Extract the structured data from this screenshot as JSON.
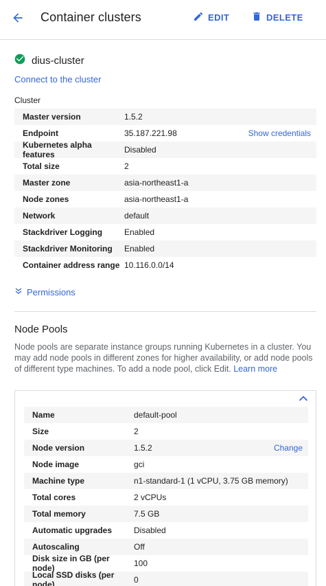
{
  "header": {
    "title": "Container clusters",
    "edit_label": "EDIT",
    "delete_label": "DELETE"
  },
  "cluster": {
    "name": "dius-cluster",
    "status": "running",
    "connect_label": "Connect to the cluster",
    "section_label": "Cluster",
    "details": [
      {
        "key": "Master version",
        "value": "1.5.2"
      },
      {
        "key": "Endpoint",
        "value": "35.187.221.98",
        "link": "Show credentials"
      },
      {
        "key": "Kubernetes alpha features",
        "value": "Disabled"
      },
      {
        "key": "Total size",
        "value": "2"
      },
      {
        "key": "Master zone",
        "value": "asia-northeast1-a"
      },
      {
        "key": "Node zones",
        "value": "asia-northeast1-a"
      },
      {
        "key": "Network",
        "value": "default"
      },
      {
        "key": "Stackdriver Logging",
        "value": "Enabled"
      },
      {
        "key": "Stackdriver Monitoring",
        "value": "Enabled"
      },
      {
        "key": "Container address range",
        "value": "10.116.0.0/14"
      }
    ],
    "permissions_label": "Permissions"
  },
  "node_pools": {
    "title": "Node Pools",
    "description": "Node pools are separate instance groups running Kubernetes in a cluster. You may add node pools in different zones for higher availability, or add node pools of different type machines. To add a node pool, click Edit.",
    "learn_more": "Learn more",
    "pool": [
      {
        "key": "Name",
        "value": "default-pool"
      },
      {
        "key": "Size",
        "value": "2"
      },
      {
        "key": "Node version",
        "value": "1.5.2",
        "link": "Change"
      },
      {
        "key": "Node image",
        "value": "gci"
      },
      {
        "key": "Machine type",
        "value": "n1-standard-1 (1 vCPU, 3.75 GB memory)"
      },
      {
        "key": "Total cores",
        "value": "2 vCPUs"
      },
      {
        "key": "Total memory",
        "value": "7.5 GB"
      },
      {
        "key": "Automatic upgrades",
        "value": "Disabled"
      },
      {
        "key": "Autoscaling",
        "value": "Off"
      },
      {
        "key": "Disk size in GB (per node)",
        "value": "100"
      },
      {
        "key": "Local SSD disks (per node)",
        "value": "0"
      }
    ]
  },
  "colors": {
    "accent": "#3367d6",
    "success": "#0f9d58",
    "row_alt": "#f5f5f5"
  }
}
